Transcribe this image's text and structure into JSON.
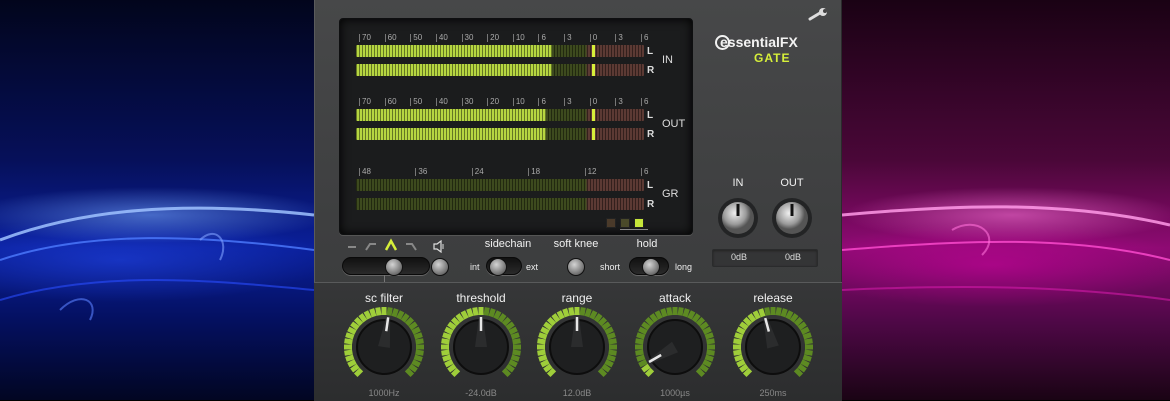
{
  "brand": {
    "name": "essentialFX",
    "product": "GATE"
  },
  "colors": {
    "meter_green": "#b6d641",
    "meter_dim": "#3d4a1e",
    "meter_red": "#5c3a34",
    "accent_yellow": "#d6ef3a",
    "panel": "#434445"
  },
  "icons": {
    "settings": "wrench-icon",
    "speaker": "speaker-icon"
  },
  "meters": {
    "in": {
      "label": "IN",
      "channels": [
        "L",
        "R"
      ],
      "scale": [
        "70",
        "60",
        "50",
        "40",
        "30",
        "20",
        "10",
        "6",
        "3",
        "0",
        "3",
        "6"
      ],
      "level": 0.68,
      "peak": 0.82
    },
    "out": {
      "label": "OUT",
      "channels": [
        "L",
        "R"
      ],
      "scale": [
        "70",
        "60",
        "50",
        "40",
        "30",
        "20",
        "10",
        "6",
        "3",
        "0",
        "3",
        "6"
      ],
      "level": 0.66,
      "peak": 0.82
    },
    "gr": {
      "label": "GR",
      "channels": [
        "L",
        "R"
      ],
      "scale": [
        "48",
        "36",
        "24",
        "18",
        "12",
        "6"
      ],
      "level": 0.0
    }
  },
  "filter_modes": [
    "low-cut",
    "band-pass",
    "peak",
    "high-cut"
  ],
  "controls": {
    "sidechain": {
      "label": "sidechain",
      "left": "int",
      "right": "ext",
      "value": "int"
    },
    "soft_knee": {
      "label": "soft knee"
    },
    "hold": {
      "label": "hold",
      "left": "short",
      "right": "long",
      "value": "short"
    }
  },
  "gain": {
    "in": {
      "label": "IN",
      "value": "0dB"
    },
    "out": {
      "label": "OUT",
      "value": "0dB"
    }
  },
  "knobs": [
    {
      "id": "sc_filter",
      "label": "sc filter",
      "value": "1000Hz",
      "rotation": 8
    },
    {
      "id": "threshold",
      "label": "threshold",
      "value": "-24.0dB",
      "rotation": 0
    },
    {
      "id": "range",
      "label": "range",
      "value": "12.0dB",
      "rotation": 0
    },
    {
      "id": "attack",
      "label": "attack",
      "value": "1000µs",
      "rotation": -120
    },
    {
      "id": "release",
      "label": "release",
      "value": "250ms",
      "rotation": -15
    }
  ]
}
